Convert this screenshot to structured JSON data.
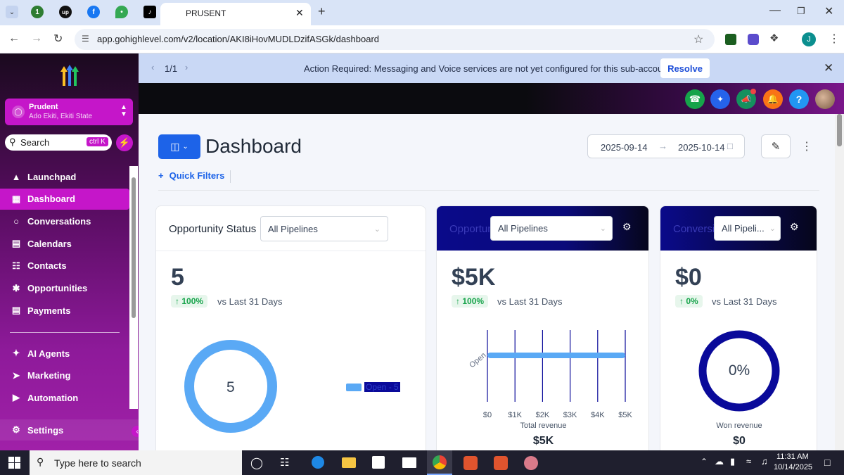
{
  "browser": {
    "tab_title": "PRUSENT",
    "url": "app.gohighlevel.com/v2/location/AKI8iHovMUDLDzifASGk/dashboard",
    "profile_initial": "J",
    "pinned_badge": "1"
  },
  "sidebar": {
    "account_name": "Prudent",
    "account_location": "Ado Ekiti, Ekiti State",
    "search_label": "Search",
    "search_shortcut": "ctrl K",
    "items": [
      {
        "label": "Launchpad",
        "icon": "rocket-icon"
      },
      {
        "label": "Dashboard",
        "icon": "grid-icon"
      },
      {
        "label": "Conversations",
        "icon": "chat-icon"
      },
      {
        "label": "Calendars",
        "icon": "calendar-icon"
      },
      {
        "label": "Contacts",
        "icon": "contacts-icon"
      },
      {
        "label": "Opportunities",
        "icon": "network-icon"
      },
      {
        "label": "Payments",
        "icon": "invoice-icon"
      }
    ],
    "items2": [
      {
        "label": "AI Agents",
        "icon": "sparkle-icon"
      },
      {
        "label": "Marketing",
        "icon": "send-icon"
      },
      {
        "label": "Automation",
        "icon": "play-icon"
      }
    ],
    "settings_label": "Settings"
  },
  "banner": {
    "pager": "1/1",
    "message": "Action Required: Messaging and Voice services are not yet configured for this sub-account!",
    "resolve_label": "Resolve"
  },
  "page": {
    "title": "Dashboard",
    "date_start": "2025-09-14",
    "date_end": "2025-10-14",
    "quick_filters_label": "Quick Filters"
  },
  "cards": [
    {
      "title": "Opportunity Status",
      "pipeline": "All Pipelines",
      "value": "5",
      "change": "100%",
      "vs": "vs Last 31 Days",
      "donut_center": "5",
      "legend": "Open - 5"
    },
    {
      "title": "Opportunity Value",
      "pipeline": "All Pipelines",
      "value": "$5K",
      "change": "100%",
      "vs": "vs Last 31 Days",
      "footer_label": "Total revenue",
      "footer_value": "$5K"
    },
    {
      "title": "Conversion Rate",
      "pipeline": "All Pipeli...",
      "value": "$0",
      "change": "0%",
      "vs": "vs Last 31 Days",
      "donut_center": "0%",
      "footer_label": "Won revenue",
      "footer_value": "$0"
    }
  ],
  "chart_data": {
    "type": "bar",
    "orientation": "horizontal",
    "categories": [
      "Open"
    ],
    "values": [
      5000
    ],
    "x_ticks": [
      "$0",
      "$1K",
      "$2K",
      "$3K",
      "$4K",
      "$5K"
    ],
    "xlim": [
      0,
      5000
    ],
    "xlabel": "Total revenue",
    "color": "#5aa9f5"
  },
  "taskbar": {
    "search_placeholder": "Type here to search",
    "time": "11:31 AM",
    "date": "10/14/2025"
  },
  "colors": {
    "accent": "#d11fd6",
    "primary": "#2563eb",
    "donut": "#5aa9f5",
    "navy": "#0a0a9a"
  }
}
